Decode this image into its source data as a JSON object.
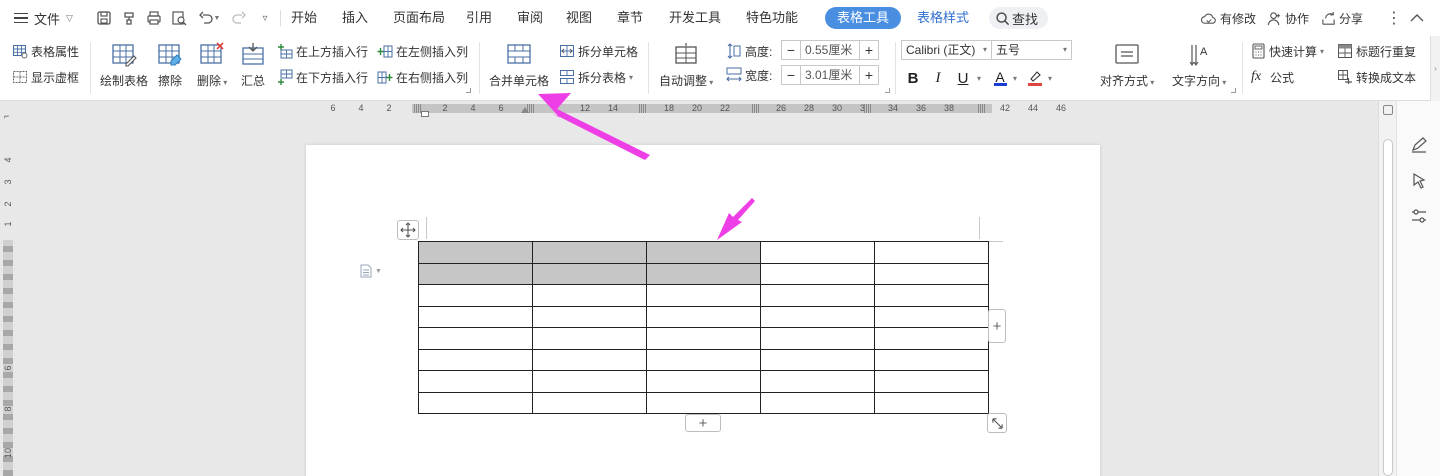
{
  "menubar": {
    "file_label": "文件",
    "tabs": [
      {
        "label": "开始"
      },
      {
        "label": "插入"
      },
      {
        "label": "页面布局"
      },
      {
        "label": "引用"
      },
      {
        "label": "审阅"
      },
      {
        "label": "视图"
      },
      {
        "label": "章节"
      },
      {
        "label": "开发工具"
      },
      {
        "label": "特色功能"
      },
      {
        "label": "表格工具"
      },
      {
        "label": "表格样式"
      }
    ],
    "search_label": "查找",
    "has_changes_label": "有修改",
    "collab_label": "协作",
    "share_label": "分享"
  },
  "ribbon": {
    "table_props": "表格属性",
    "show_gridlines": "显示虚框",
    "draw_table": "绘制表格",
    "erase": "擦除",
    "delete": "删除",
    "summary": "汇总",
    "insert_above": "在上方插入行",
    "insert_below": "在下方插入行",
    "insert_left": "在左侧插入列",
    "insert_right": "在右侧插入列",
    "merge_cells": "合并单元格",
    "split_cells": "拆分单元格",
    "split_table": "拆分表格",
    "auto_fit": "自动调整",
    "height_label": "高度:",
    "height_value": "0.55厘米",
    "width_label": "宽度:",
    "width_value": "3.01厘米",
    "font_name": "Calibri (正文)",
    "font_size": "五号",
    "bold": "B",
    "italic": "I",
    "underline": "U",
    "font_color": "A",
    "align": "对齐方式",
    "text_direction": "文字方向",
    "quick_calc": "快速计算",
    "formula": "公式",
    "repeat_header": "标题行重复",
    "convert_text": "转换成文本"
  },
  "ruler": {
    "h_numbers": [
      "6",
      "4",
      "2",
      "2",
      "4",
      "6",
      "12",
      "14",
      "18",
      "20",
      "22",
      "26",
      "28",
      "30",
      "32",
      "34",
      "36",
      "38",
      "42",
      "44",
      "46"
    ],
    "v_numbers": [
      "4",
      "3",
      "2",
      "1",
      "6",
      "8",
      "10"
    ]
  },
  "table": {
    "rows": 8,
    "cols": 5,
    "selected_rows": 2,
    "selected_cols": 3
  },
  "colors": {
    "accent": "#4a8ee2",
    "arrow": "#ee3fe6",
    "selection": "#c6c6c6"
  }
}
